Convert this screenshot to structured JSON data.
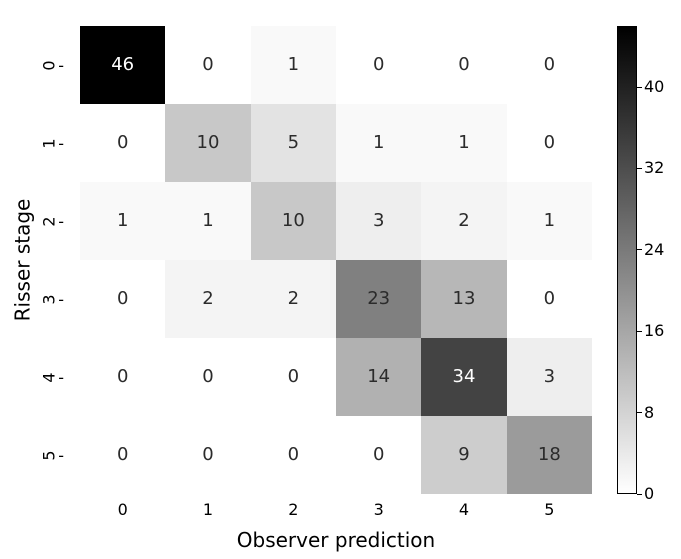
{
  "chart_data": {
    "type": "heatmap",
    "xlabel": "Observer prediction",
    "ylabel": "Risser stage",
    "x_categories": [
      "0",
      "1",
      "2",
      "3",
      "4",
      "5"
    ],
    "y_categories": [
      "0",
      "1",
      "2",
      "3",
      "4",
      "5"
    ],
    "matrix": [
      [
        46,
        0,
        1,
        0,
        0,
        0
      ],
      [
        0,
        10,
        5,
        1,
        1,
        0
      ],
      [
        1,
        1,
        10,
        3,
        2,
        1
      ],
      [
        0,
        2,
        2,
        23,
        13,
        0
      ],
      [
        0,
        0,
        0,
        14,
        34,
        3
      ],
      [
        0,
        0,
        0,
        0,
        9,
        18
      ]
    ],
    "colorbar": {
      "vmin": 0,
      "vmax": 46,
      "ticks": [
        0,
        8,
        16,
        24,
        32,
        40
      ]
    }
  }
}
